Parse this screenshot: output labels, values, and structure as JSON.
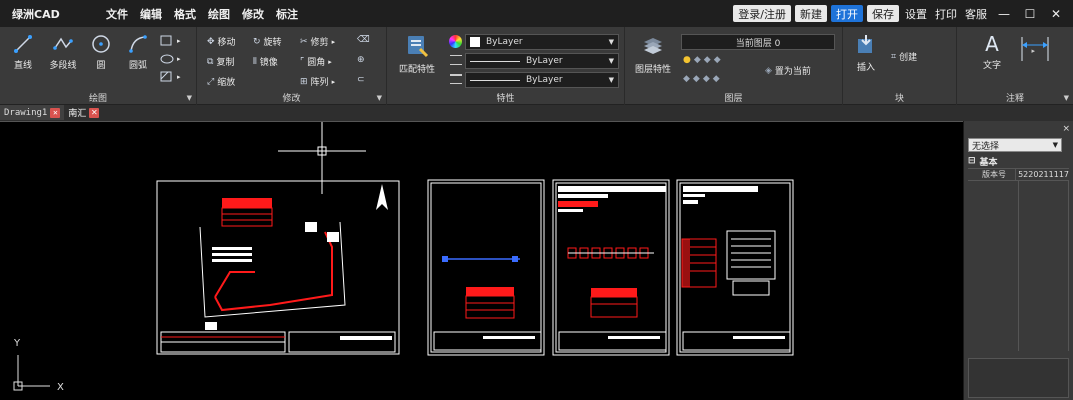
{
  "app": {
    "title": "绿洲CAD",
    "menu": [
      "文件",
      "编辑",
      "格式",
      "绘图",
      "修改",
      "标注"
    ],
    "login": "登录/注册",
    "new": "新建",
    "open": "打开",
    "save": "保存",
    "settings": "设置",
    "print": "打印",
    "service": "客服",
    "minimize": "—",
    "maximize": "☐",
    "close": "✕"
  },
  "ribbon": {
    "draw": {
      "label": "绘图",
      "tools": [
        "直线",
        "多段线",
        "圆",
        "圆弧"
      ]
    },
    "modify": {
      "label": "修改",
      "tools": [
        "移动",
        "旋转",
        "修剪",
        "复制",
        "镜像",
        "圆角",
        "缩放",
        "阵列"
      ]
    },
    "props": {
      "label": "特性",
      "match": "匹配特性",
      "color": "ByLayer",
      "linetype": "ByLayer",
      "lineweight": "ByLayer"
    },
    "layer": {
      "label": "图层",
      "layer_props": "图层特性",
      "current_layer": "当前图层 0",
      "set_current": "置为当前"
    },
    "block": {
      "label": "块",
      "insert": "插入",
      "create": "创建"
    },
    "annotate": {
      "label": "注释",
      "text": "文字"
    }
  },
  "tabs": [
    {
      "label": "Drawing1",
      "close": "✕"
    },
    {
      "label": "南汇",
      "close": "✕"
    }
  ],
  "canvas": {
    "axis_y": "Y",
    "axis_x": "X"
  },
  "panel": {
    "close": "×",
    "selection": "无选择",
    "category": "基本",
    "category_toggle": "⊟",
    "property_name": "版本号",
    "property_value": "5220211117"
  },
  "colors": {
    "accent_blue": "#1e73d9",
    "drawing_red": "#ff1a1a",
    "canvas_bg": "#000000"
  }
}
